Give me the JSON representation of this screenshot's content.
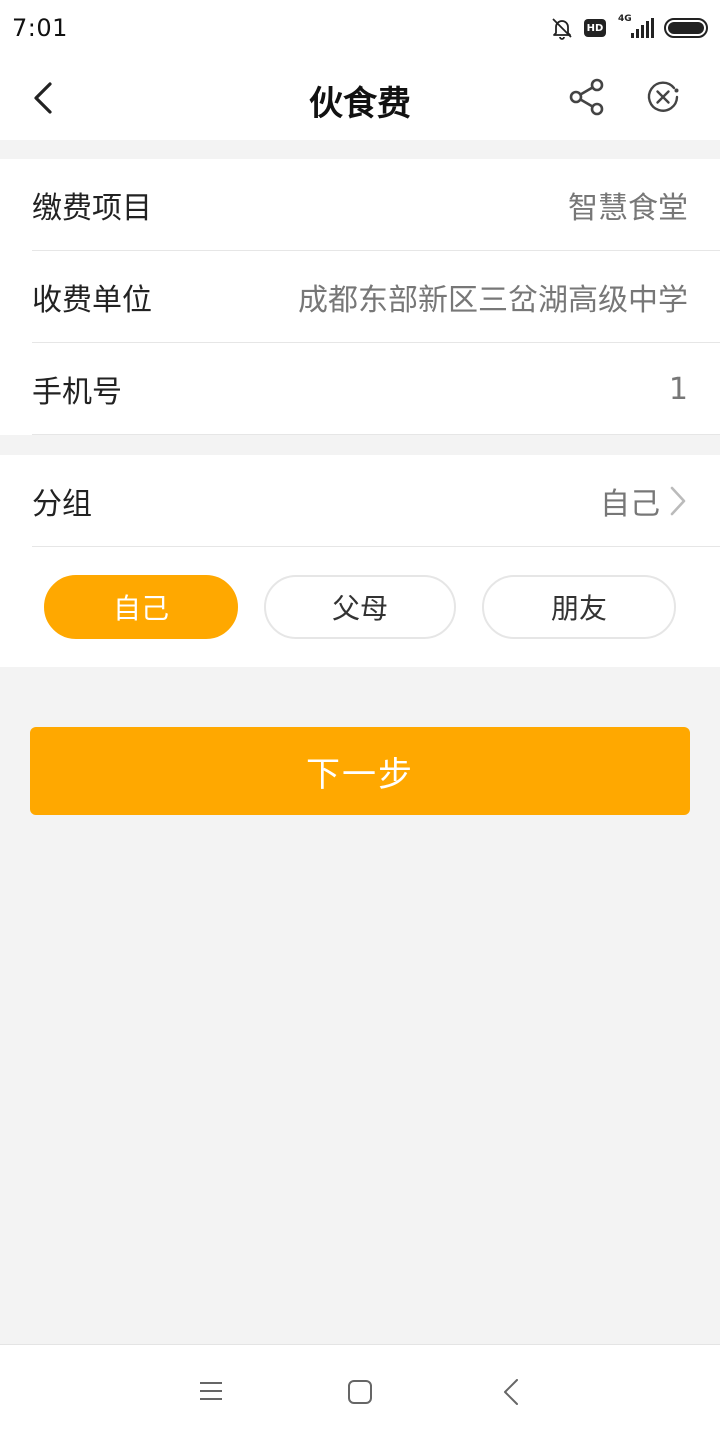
{
  "status_bar": {
    "time": "7:01",
    "icons": [
      "bell-off-icon",
      "hd-badge",
      "signal-4g-icon",
      "battery-icon"
    ],
    "hd_label": "HD",
    "network_label": "4G"
  },
  "nav": {
    "title": "伙食费",
    "back_icon": "chevron-left-icon",
    "share_icon": "share-icon",
    "close_icon": "close-circle-icon"
  },
  "info": {
    "rows": [
      {
        "label": "缴费项目",
        "value": "智慧食堂"
      },
      {
        "label": "收费单位",
        "value": "成都东部新区三岔湖高级中学"
      },
      {
        "label": "手机号",
        "value": "1"
      }
    ]
  },
  "group": {
    "label": "分组",
    "value": "自己",
    "chips": [
      {
        "label": "自己",
        "active": true
      },
      {
        "label": "父母",
        "active": false
      },
      {
        "label": "朋友",
        "active": false
      }
    ]
  },
  "next_button": {
    "label": "下一步"
  },
  "colors": {
    "accent": "#ffa800",
    "background": "#f3f3f3",
    "text": "#222222",
    "secondary_text": "#777777"
  },
  "system_nav": {
    "icons": [
      "menu-icon",
      "home-square-icon",
      "back-chevron-icon"
    ]
  }
}
